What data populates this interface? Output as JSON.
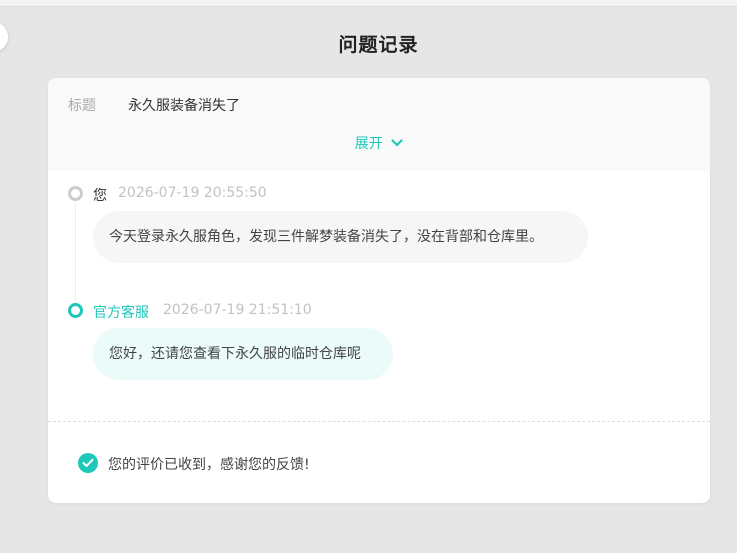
{
  "page": {
    "title": "问题记录"
  },
  "ticket": {
    "title_label": "标题",
    "title_value": "永久服装备消失了",
    "expand_label": "展开"
  },
  "messages": [
    {
      "author": "您",
      "time": "2026-07-19 20:55:50",
      "text": "今天登录永久服角色，发现三件解梦装备消失了，没在背部和仓库里。"
    },
    {
      "author": "官方客服",
      "time": "2026-07-19 21:51:10",
      "text": "您好，还请您查看下永久服的临时仓库呢"
    }
  ],
  "feedback": {
    "text": "您的评价已收到，感谢您的反馈!"
  },
  "colors": {
    "accent": "#1ec8b9",
    "background": "#e6e6e6",
    "card": "#ffffff",
    "header": "#f9f9f9",
    "user_bubble": "#f6f6f6",
    "agent_bubble": "#ebfbf9",
    "muted_text": "#c2c2c2"
  },
  "icons": {
    "expand": "chevron-down-icon",
    "feedback": "check-circle-icon",
    "user_dot": "timeline-dot-icon",
    "agent_dot": "timeline-dot-icon"
  }
}
